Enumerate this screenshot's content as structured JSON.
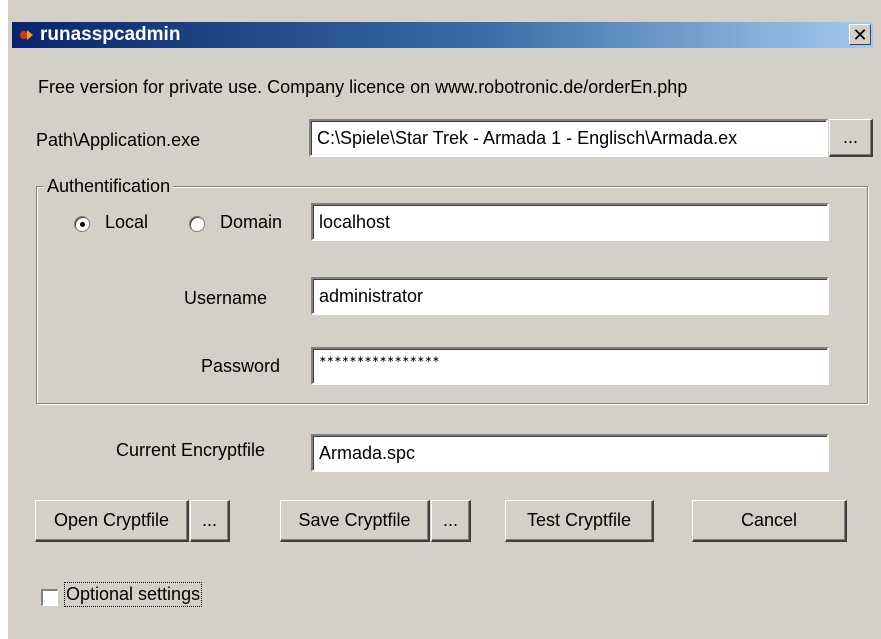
{
  "window": {
    "title": "runasspcadmin",
    "close_label": "✕"
  },
  "info_text": "Free version for private use. Company licence on www.robotronic.de/orderEn.php",
  "path": {
    "label": "Path\\Application.exe",
    "value": "C:\\Spiele\\Star Trek - Armada 1 - Englisch\\Armada.ex",
    "browse_label": "..."
  },
  "auth": {
    "legend": "Authentification",
    "local_label": "Local",
    "domain_label": "Domain",
    "selected": "Local",
    "domain_value": "localhost",
    "username_label": "Username",
    "username_value": "administrator",
    "password_label": "Password",
    "password_value": "∗∗∗∗∗∗∗∗∗∗∗∗∗∗∗∗"
  },
  "encrypt": {
    "label": "Current Encryptfile",
    "value": "Armada.spc"
  },
  "buttons": {
    "open": "Open Cryptfile",
    "open_browse": "...",
    "save": "Save Cryptfile",
    "save_browse": "...",
    "test": "Test Cryptfile",
    "cancel": "Cancel"
  },
  "optional": {
    "label": "Optional settings",
    "checked": false
  }
}
